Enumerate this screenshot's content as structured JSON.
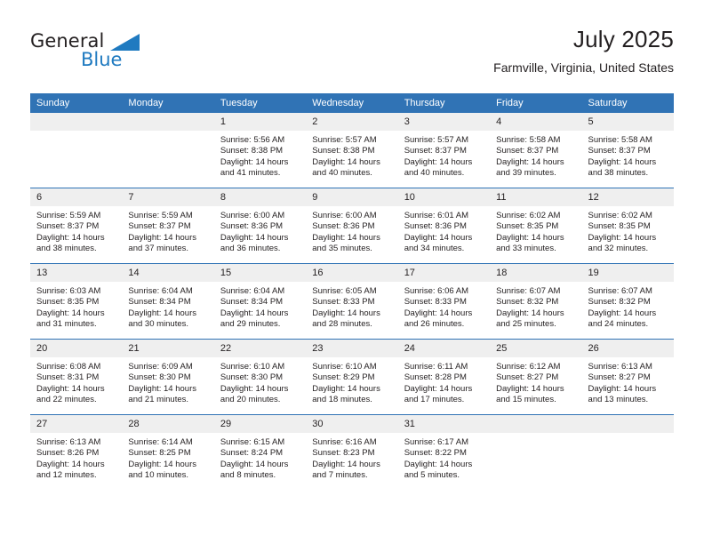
{
  "logo": {
    "word_top": "General",
    "word_bottom": "Blue",
    "triangle": "blue-triangle-icon",
    "color_dark": "#231f20",
    "color_blue": "#1f7ac0"
  },
  "header": {
    "title": "July 2025",
    "subtitle": "Farmville, Virginia, United States"
  },
  "theme": {
    "header_blue": "#3073b5",
    "daynum_gray": "#efefef",
    "text": "#231f20"
  },
  "weekday_headers": [
    "Sunday",
    "Monday",
    "Tuesday",
    "Wednesday",
    "Thursday",
    "Friday",
    "Saturday"
  ],
  "labels": {
    "sunrise": "Sunrise:",
    "sunset": "Sunset:",
    "daylight": "Daylight:"
  },
  "weeks": [
    [
      {
        "day": "",
        "sunrise": "",
        "sunset": "",
        "daylight_line1": "",
        "daylight_line2": ""
      },
      {
        "day": "",
        "sunrise": "",
        "sunset": "",
        "daylight_line1": "",
        "daylight_line2": ""
      },
      {
        "day": "1",
        "sunrise": "Sunrise: 5:56 AM",
        "sunset": "Sunset: 8:38 PM",
        "daylight_line1": "Daylight: 14 hours",
        "daylight_line2": "and 41 minutes."
      },
      {
        "day": "2",
        "sunrise": "Sunrise: 5:57 AM",
        "sunset": "Sunset: 8:38 PM",
        "daylight_line1": "Daylight: 14 hours",
        "daylight_line2": "and 40 minutes."
      },
      {
        "day": "3",
        "sunrise": "Sunrise: 5:57 AM",
        "sunset": "Sunset: 8:37 PM",
        "daylight_line1": "Daylight: 14 hours",
        "daylight_line2": "and 40 minutes."
      },
      {
        "day": "4",
        "sunrise": "Sunrise: 5:58 AM",
        "sunset": "Sunset: 8:37 PM",
        "daylight_line1": "Daylight: 14 hours",
        "daylight_line2": "and 39 minutes."
      },
      {
        "day": "5",
        "sunrise": "Sunrise: 5:58 AM",
        "sunset": "Sunset: 8:37 PM",
        "daylight_line1": "Daylight: 14 hours",
        "daylight_line2": "and 38 minutes."
      }
    ],
    [
      {
        "day": "6",
        "sunrise": "Sunrise: 5:59 AM",
        "sunset": "Sunset: 8:37 PM",
        "daylight_line1": "Daylight: 14 hours",
        "daylight_line2": "and 38 minutes."
      },
      {
        "day": "7",
        "sunrise": "Sunrise: 5:59 AM",
        "sunset": "Sunset: 8:37 PM",
        "daylight_line1": "Daylight: 14 hours",
        "daylight_line2": "and 37 minutes."
      },
      {
        "day": "8",
        "sunrise": "Sunrise: 6:00 AM",
        "sunset": "Sunset: 8:36 PM",
        "daylight_line1": "Daylight: 14 hours",
        "daylight_line2": "and 36 minutes."
      },
      {
        "day": "9",
        "sunrise": "Sunrise: 6:00 AM",
        "sunset": "Sunset: 8:36 PM",
        "daylight_line1": "Daylight: 14 hours",
        "daylight_line2": "and 35 minutes."
      },
      {
        "day": "10",
        "sunrise": "Sunrise: 6:01 AM",
        "sunset": "Sunset: 8:36 PM",
        "daylight_line1": "Daylight: 14 hours",
        "daylight_line2": "and 34 minutes."
      },
      {
        "day": "11",
        "sunrise": "Sunrise: 6:02 AM",
        "sunset": "Sunset: 8:35 PM",
        "daylight_line1": "Daylight: 14 hours",
        "daylight_line2": "and 33 minutes."
      },
      {
        "day": "12",
        "sunrise": "Sunrise: 6:02 AM",
        "sunset": "Sunset: 8:35 PM",
        "daylight_line1": "Daylight: 14 hours",
        "daylight_line2": "and 32 minutes."
      }
    ],
    [
      {
        "day": "13",
        "sunrise": "Sunrise: 6:03 AM",
        "sunset": "Sunset: 8:35 PM",
        "daylight_line1": "Daylight: 14 hours",
        "daylight_line2": "and 31 minutes."
      },
      {
        "day": "14",
        "sunrise": "Sunrise: 6:04 AM",
        "sunset": "Sunset: 8:34 PM",
        "daylight_line1": "Daylight: 14 hours",
        "daylight_line2": "and 30 minutes."
      },
      {
        "day": "15",
        "sunrise": "Sunrise: 6:04 AM",
        "sunset": "Sunset: 8:34 PM",
        "daylight_line1": "Daylight: 14 hours",
        "daylight_line2": "and 29 minutes."
      },
      {
        "day": "16",
        "sunrise": "Sunrise: 6:05 AM",
        "sunset": "Sunset: 8:33 PM",
        "daylight_line1": "Daylight: 14 hours",
        "daylight_line2": "and 28 minutes."
      },
      {
        "day": "17",
        "sunrise": "Sunrise: 6:06 AM",
        "sunset": "Sunset: 8:33 PM",
        "daylight_line1": "Daylight: 14 hours",
        "daylight_line2": "and 26 minutes."
      },
      {
        "day": "18",
        "sunrise": "Sunrise: 6:07 AM",
        "sunset": "Sunset: 8:32 PM",
        "daylight_line1": "Daylight: 14 hours",
        "daylight_line2": "and 25 minutes."
      },
      {
        "day": "19",
        "sunrise": "Sunrise: 6:07 AM",
        "sunset": "Sunset: 8:32 PM",
        "daylight_line1": "Daylight: 14 hours",
        "daylight_line2": "and 24 minutes."
      }
    ],
    [
      {
        "day": "20",
        "sunrise": "Sunrise: 6:08 AM",
        "sunset": "Sunset: 8:31 PM",
        "daylight_line1": "Daylight: 14 hours",
        "daylight_line2": "and 22 minutes."
      },
      {
        "day": "21",
        "sunrise": "Sunrise: 6:09 AM",
        "sunset": "Sunset: 8:30 PM",
        "daylight_line1": "Daylight: 14 hours",
        "daylight_line2": "and 21 minutes."
      },
      {
        "day": "22",
        "sunrise": "Sunrise: 6:10 AM",
        "sunset": "Sunset: 8:30 PM",
        "daylight_line1": "Daylight: 14 hours",
        "daylight_line2": "and 20 minutes."
      },
      {
        "day": "23",
        "sunrise": "Sunrise: 6:10 AM",
        "sunset": "Sunset: 8:29 PM",
        "daylight_line1": "Daylight: 14 hours",
        "daylight_line2": "and 18 minutes."
      },
      {
        "day": "24",
        "sunrise": "Sunrise: 6:11 AM",
        "sunset": "Sunset: 8:28 PM",
        "daylight_line1": "Daylight: 14 hours",
        "daylight_line2": "and 17 minutes."
      },
      {
        "day": "25",
        "sunrise": "Sunrise: 6:12 AM",
        "sunset": "Sunset: 8:27 PM",
        "daylight_line1": "Daylight: 14 hours",
        "daylight_line2": "and 15 minutes."
      },
      {
        "day": "26",
        "sunrise": "Sunrise: 6:13 AM",
        "sunset": "Sunset: 8:27 PM",
        "daylight_line1": "Daylight: 14 hours",
        "daylight_line2": "and 13 minutes."
      }
    ],
    [
      {
        "day": "27",
        "sunrise": "Sunrise: 6:13 AM",
        "sunset": "Sunset: 8:26 PM",
        "daylight_line1": "Daylight: 14 hours",
        "daylight_line2": "and 12 minutes."
      },
      {
        "day": "28",
        "sunrise": "Sunrise: 6:14 AM",
        "sunset": "Sunset: 8:25 PM",
        "daylight_line1": "Daylight: 14 hours",
        "daylight_line2": "and 10 minutes."
      },
      {
        "day": "29",
        "sunrise": "Sunrise: 6:15 AM",
        "sunset": "Sunset: 8:24 PM",
        "daylight_line1": "Daylight: 14 hours",
        "daylight_line2": "and 8 minutes."
      },
      {
        "day": "30",
        "sunrise": "Sunrise: 6:16 AM",
        "sunset": "Sunset: 8:23 PM",
        "daylight_line1": "Daylight: 14 hours",
        "daylight_line2": "and 7 minutes."
      },
      {
        "day": "31",
        "sunrise": "Sunrise: 6:17 AM",
        "sunset": "Sunset: 8:22 PM",
        "daylight_line1": "Daylight: 14 hours",
        "daylight_line2": "and 5 minutes."
      },
      {
        "day": "",
        "sunrise": "",
        "sunset": "",
        "daylight_line1": "",
        "daylight_line2": ""
      },
      {
        "day": "",
        "sunrise": "",
        "sunset": "",
        "daylight_line1": "",
        "daylight_line2": ""
      }
    ]
  ]
}
